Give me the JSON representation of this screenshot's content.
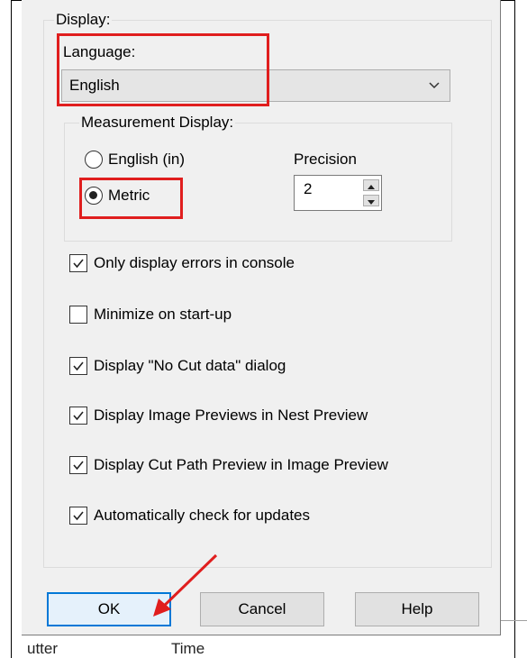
{
  "display": {
    "group_label": "Display:",
    "language_label": "Language:",
    "language_value": "English",
    "measurement": {
      "group_label": "Measurement Display:",
      "option_english": "English (in)",
      "option_metric": "Metric",
      "selected": "Metric",
      "precision_label": "Precision",
      "precision_value": "2"
    },
    "checkboxes": [
      {
        "label": "Only display errors in console",
        "checked": true
      },
      {
        "label": "Minimize on start-up",
        "checked": false
      },
      {
        "label": "Display \"No Cut data\" dialog",
        "checked": true
      },
      {
        "label": "Display Image Previews in Nest Preview",
        "checked": true
      },
      {
        "label": "Display Cut Path Preview in Image Preview",
        "checked": true
      },
      {
        "label": "Automatically check for updates",
        "checked": true
      }
    ]
  },
  "buttons": {
    "ok": "OK",
    "cancel": "Cancel",
    "help": "Help"
  },
  "background_text": {
    "left": "utter",
    "right": "Time"
  },
  "colors": {
    "highlight": "#e01e1e",
    "default_button_border": "#0078d7"
  }
}
